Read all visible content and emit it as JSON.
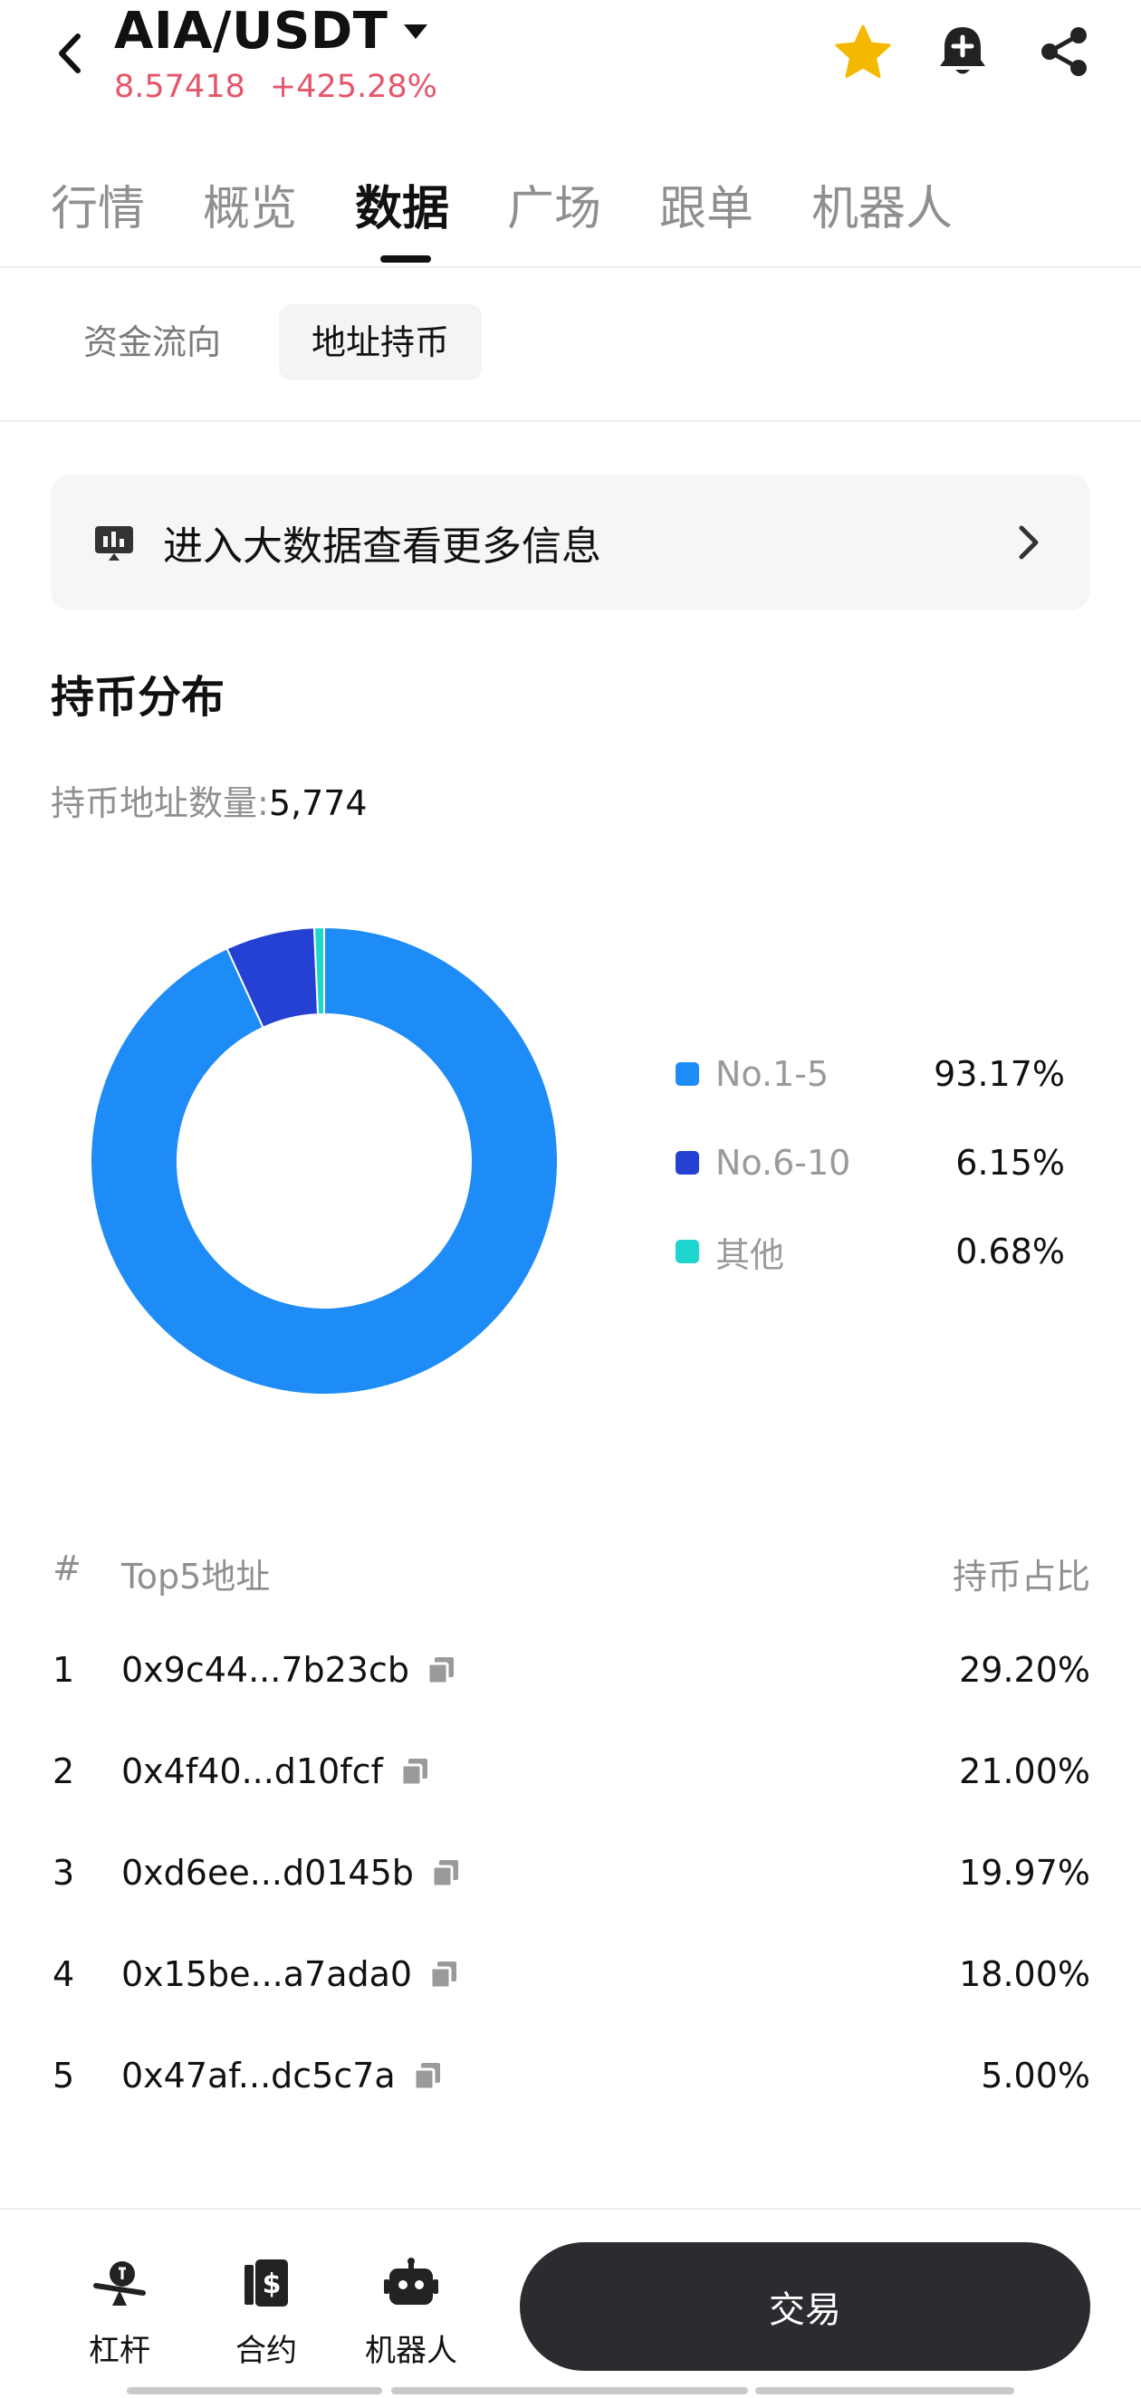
{
  "header": {
    "pair": "AIA/USDT",
    "price": "8.57418",
    "change": "+425.28%",
    "icons": [
      "back-arrow-icon",
      "caret-down-icon",
      "star-icon",
      "bell-plus-icon",
      "share-icon"
    ],
    "colors": {
      "favorite": "#f5b800",
      "price_up": "#e5566b"
    }
  },
  "main_tabs": [
    {
      "label": "行情"
    },
    {
      "label": "概览"
    },
    {
      "label": "数据"
    },
    {
      "label": "广场"
    },
    {
      "label": "跟单"
    },
    {
      "label": "机器人"
    }
  ],
  "sub_tabs": [
    {
      "label": "资金流向"
    },
    {
      "label": "地址持币"
    }
  ],
  "banner": {
    "text": "进入大数据查看更多信息"
  },
  "distribution": {
    "title": "持币分布",
    "count_label": "持币地址数量:",
    "count_value": "5,774"
  },
  "chart_data": {
    "type": "pie",
    "donut": true,
    "title": "",
    "categories": [
      "No.1-5",
      "No.6-10",
      "其他"
    ],
    "values": [
      93.17,
      6.15,
      0.68
    ],
    "value_labels": [
      "93.17%",
      "6.15%",
      "0.68%"
    ],
    "colors": [
      "#1e8cf6",
      "#2441d4",
      "#1fd5d0"
    ],
    "legend": "right"
  },
  "table": {
    "headers": {
      "rank": "#",
      "address": "Top5地址",
      "share": "持币占比"
    },
    "rows": [
      {
        "rank": "1",
        "address": "0x9c44...7b23cb",
        "share": "29.20%"
      },
      {
        "rank": "2",
        "address": "0x4f40...d10fcf",
        "share": "21.00%"
      },
      {
        "rank": "3",
        "address": "0xd6ee...d0145b",
        "share": "19.97%"
      },
      {
        "rank": "4",
        "address": "0x15be...a7ada0",
        "share": "18.00%"
      },
      {
        "rank": "5",
        "address": "0x47af...dc5c7a",
        "share": "5.00%"
      }
    ]
  },
  "bottom_bar": {
    "items": [
      {
        "label": "杠杆",
        "icon": "leverage-icon"
      },
      {
        "label": "合约",
        "icon": "contract-icon"
      },
      {
        "label": "机器人",
        "icon": "robot-icon"
      }
    ],
    "trade_label": "交易"
  }
}
